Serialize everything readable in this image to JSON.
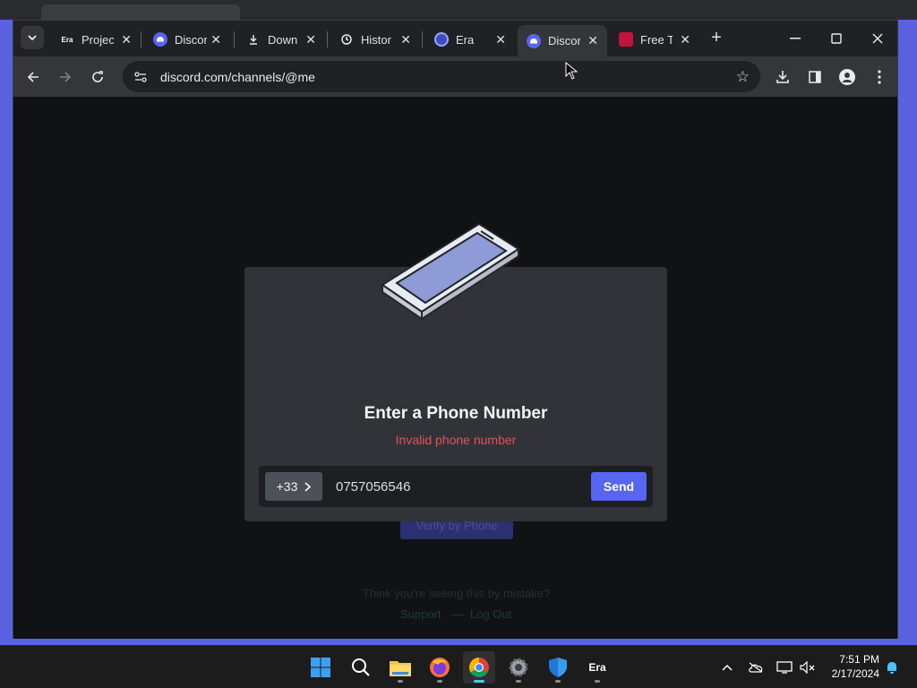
{
  "browser": {
    "tabs": [
      {
        "title": "Projec",
        "favicon": "era-logo",
        "active": false
      },
      {
        "title": "Discor",
        "favicon": "discord-icon",
        "active": false
      },
      {
        "title": "Down",
        "favicon": "download-icon",
        "active": false
      },
      {
        "title": "Histor",
        "favicon": "history-icon",
        "active": false
      },
      {
        "title": "Era",
        "favicon": "era-globe-icon",
        "active": false
      },
      {
        "title": "Discor",
        "favicon": "discord-icon",
        "active": true
      },
      {
        "title": "Free Te",
        "favicon": "red-logo-icon",
        "active": false
      }
    ],
    "favicon_text": {
      "era": "Era"
    },
    "address": "discord.com/channels/@me"
  },
  "modal": {
    "title": "Enter a Phone Number",
    "error": "Invalid phone number",
    "country_code": "+33",
    "phone_value": "0757056546",
    "send_label": "Send"
  },
  "background": {
    "verify_button": "Verify by Phone",
    "mistake_text": "Think you're seeing this by mistake?",
    "support_link": "Support",
    "separator": "—",
    "logout_link": "Log Out"
  },
  "taskbar": {
    "apps": [
      "windows-start",
      "search",
      "file-explorer",
      "firefox",
      "chrome",
      "settings",
      "windows-security",
      "era"
    ],
    "era_label": "Era",
    "time": "7:51 PM",
    "date": "2/17/2024"
  },
  "colors": {
    "accent": "#5865f2",
    "error": "#e0535a",
    "modal_bg": "#313338"
  }
}
